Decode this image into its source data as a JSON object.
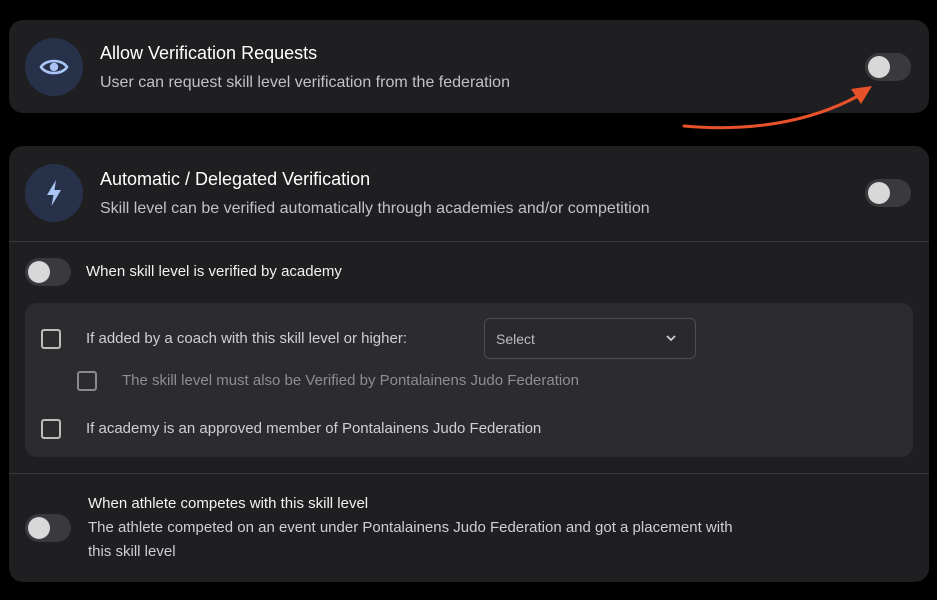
{
  "verification_requests": {
    "icon": "eye-icon",
    "title": "Allow Verification Requests",
    "description": "User can request skill level verification from the federation",
    "enabled": false
  },
  "automatic_verification": {
    "icon": "lightning-icon",
    "title": "Automatic / Delegated Verification",
    "description": "Skill level can be verified automatically through academies and/or competition",
    "enabled": false,
    "academy": {
      "label": "When skill level is verified by academy",
      "enabled": false,
      "options": {
        "coach_label": "If added by a coach with this skill level or higher:",
        "coach_checked": false,
        "coach_select": {
          "value": "Select"
        },
        "federation_verified_label": "The skill level must also be Verified by Pontalainens Judo Federation",
        "federation_verified_checked": false,
        "approved_member_label": "If academy is an approved member of Pontalainens Judo Federation",
        "approved_member_checked": false
      }
    },
    "competition": {
      "label": "When athlete competes with this skill level",
      "description": "The athlete competed on an event under Pontalainens Judo Federation and got a placement with this skill level",
      "enabled": false
    }
  },
  "colors": {
    "background": "#000000",
    "card": "#1f1f21",
    "inner_panel": "#2c2c2f",
    "icon_circle": "#27324a",
    "icon_accent": "#a9c4f5",
    "annotation_arrow": "#e8522a"
  }
}
